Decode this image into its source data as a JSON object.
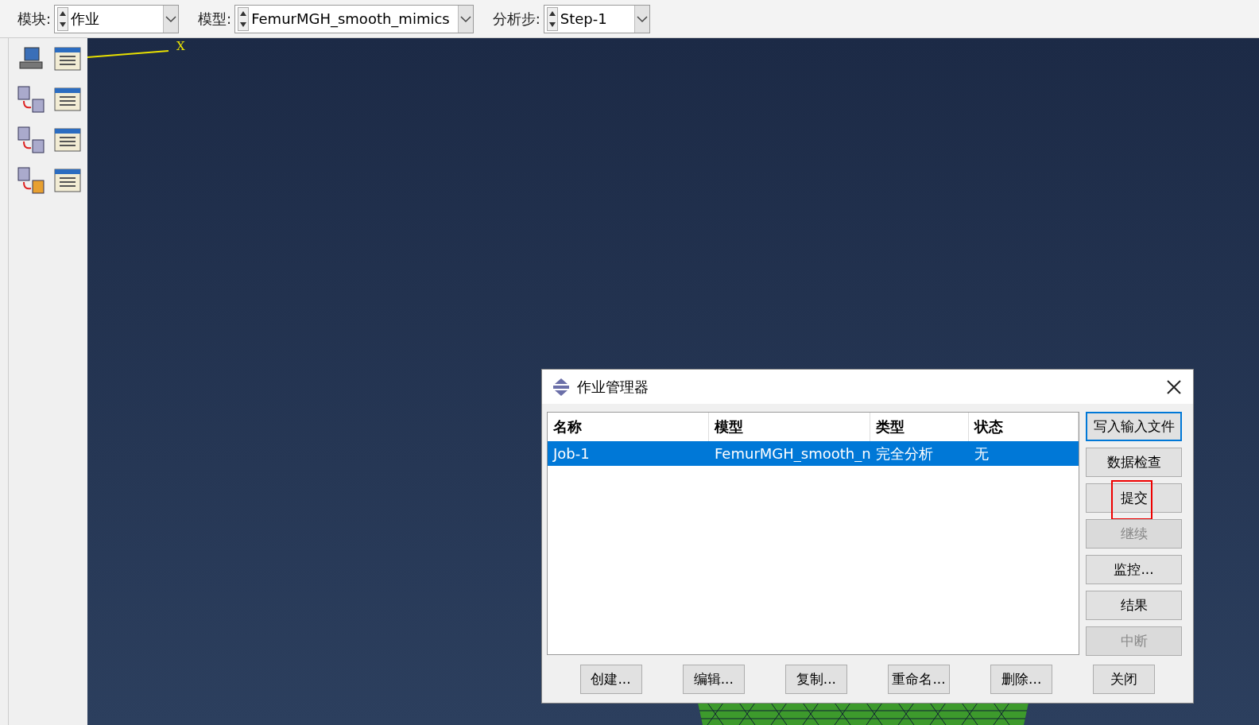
{
  "toolbar": {
    "fields": [
      {
        "label": "模块:",
        "value": "作业"
      },
      {
        "label": "模型:",
        "value": "FemurMGH_smooth_mimics"
      },
      {
        "label": "分析步:",
        "value": "Step-1"
      }
    ]
  },
  "viewport": {
    "axis_label": "X"
  },
  "dialog": {
    "title": "作业管理器",
    "columns": [
      "名称",
      "模型",
      "类型",
      "状态"
    ],
    "rows": [
      {
        "cells": [
          "Job-1",
          "FemurMGH_smooth_n",
          "完全分析",
          "无"
        ],
        "selected": true
      }
    ],
    "side_buttons": [
      {
        "label": "写入输入文件",
        "disabled": false,
        "focused": true,
        "highlighted": false
      },
      {
        "label": "数据检查",
        "disabled": false,
        "focused": false,
        "highlighted": false
      },
      {
        "label": "提交",
        "disabled": false,
        "focused": false,
        "highlighted": true
      },
      {
        "label": "继续",
        "disabled": true,
        "focused": false,
        "highlighted": false
      },
      {
        "label": "监控...",
        "disabled": false,
        "focused": false,
        "highlighted": false
      },
      {
        "label": "结果",
        "disabled": false,
        "focused": false,
        "highlighted": false
      },
      {
        "label": "中断",
        "disabled": true,
        "focused": false,
        "highlighted": false
      }
    ],
    "bottom_buttons": [
      "创建...",
      "编辑...",
      "复制...",
      "重命名...",
      "删除...",
      "关闭"
    ]
  }
}
